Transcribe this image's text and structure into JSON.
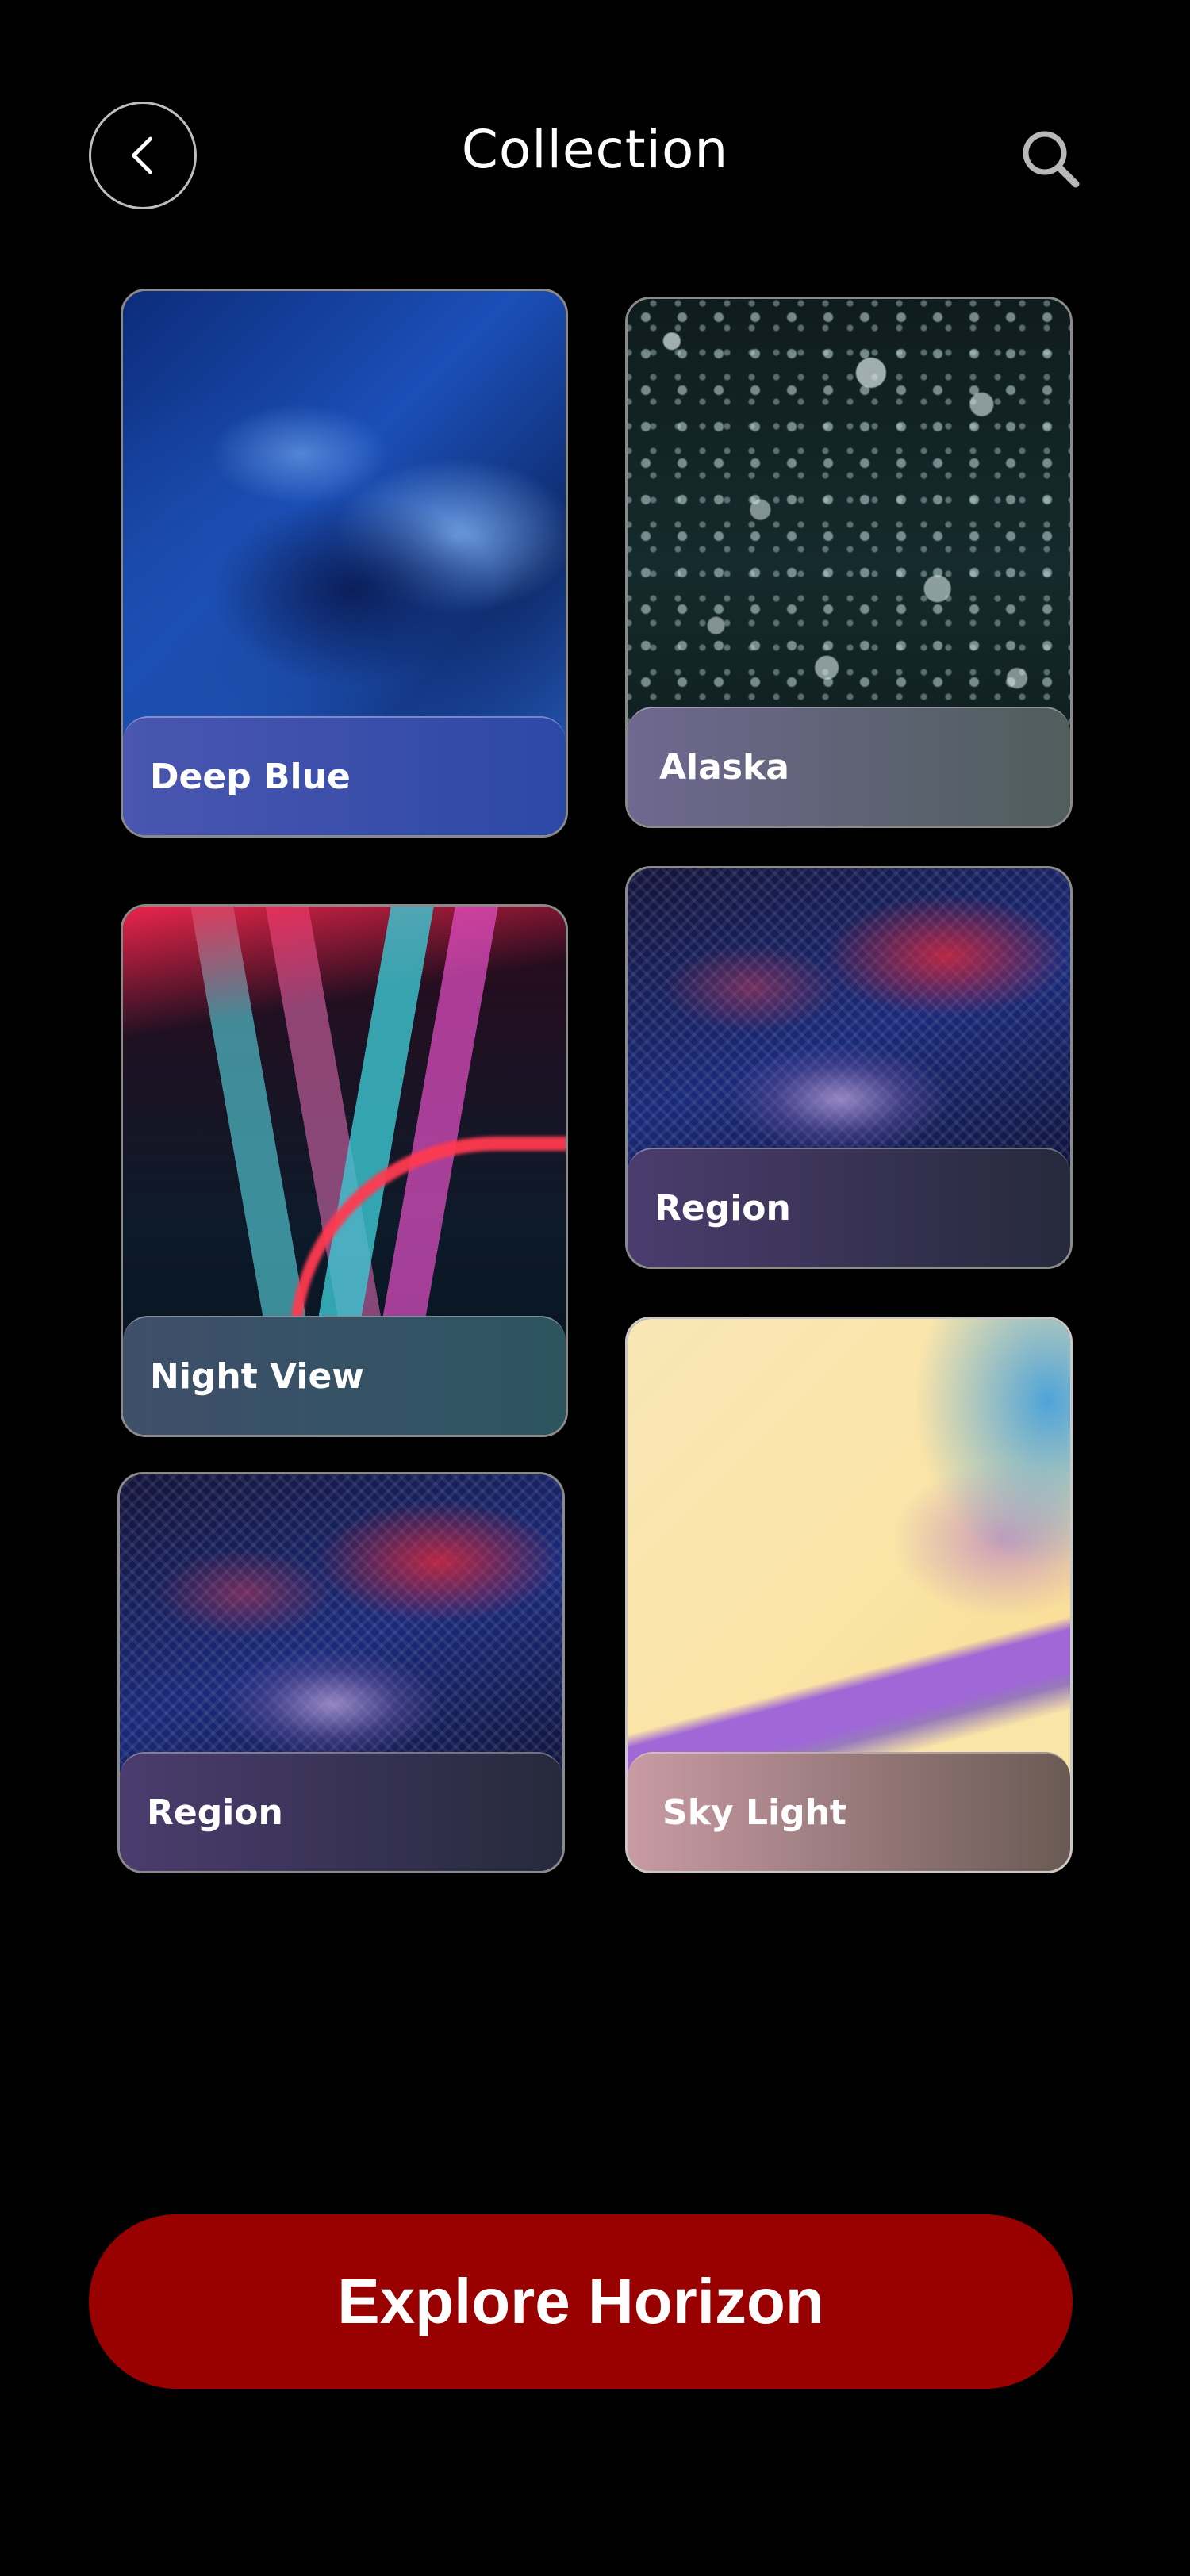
{
  "header": {
    "title": "Collection",
    "back_icon": "chevron-left-icon",
    "search_icon": "search-icon"
  },
  "cards": [
    {
      "label": "Deep Blue"
    },
    {
      "label": "Alaska"
    },
    {
      "label": "Night View"
    },
    {
      "label": "Region"
    },
    {
      "label": "Region"
    },
    {
      "label": "Sky Light"
    }
  ],
  "cta": {
    "label": "Explore Horizon"
  },
  "colors": {
    "background": "#000000",
    "cta": "#990000",
    "text": "#ffffff"
  }
}
